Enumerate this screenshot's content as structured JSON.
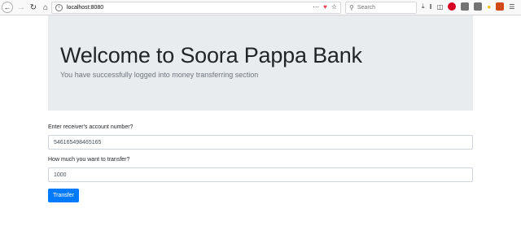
{
  "browser": {
    "url": "localhost:8080",
    "search_placeholder": "Search",
    "icons": {
      "back": "back-arrow-icon",
      "forward": "forward-arrow-icon",
      "reload": "reload-icon",
      "home": "home-icon",
      "page_actions": "more-dots-icon",
      "pocket": "pocket-icon",
      "bookmark": "star-icon",
      "downloads": "download-icon",
      "library": "library-icon",
      "sidebar": "sidebar-icon",
      "menu": "hamburger-menu-icon"
    }
  },
  "jumbotron": {
    "title": "Welcome to Soora Pappa Bank",
    "lead": "You have successfully logged into money transferring section"
  },
  "form": {
    "account_label": "Enter receiver's account number?",
    "account_value": "546165498465165",
    "amount_label": "How much you want to transfer?",
    "amount_value": "1000",
    "submit_label": "Transfer"
  },
  "colors": {
    "primary": "#007bff",
    "jumbotron_bg": "#e9ecef"
  }
}
